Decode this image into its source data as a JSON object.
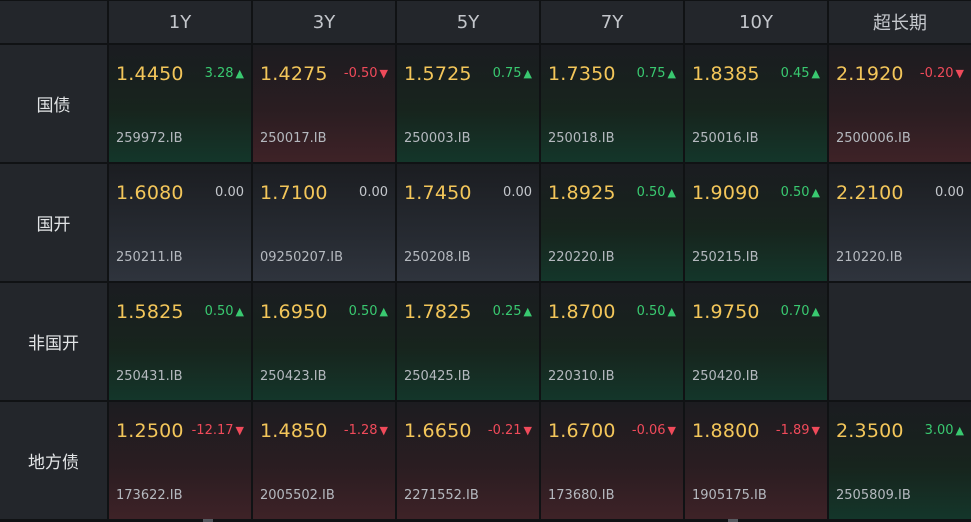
{
  "columns": [
    "1Y",
    "3Y",
    "5Y",
    "7Y",
    "10Y",
    "超长期"
  ],
  "rows": [
    {
      "label": "国债",
      "cells": [
        {
          "price": "1.4450",
          "change": "3.28",
          "trend": "up",
          "code": "259972.IB"
        },
        {
          "price": "1.4275",
          "change": "-0.50",
          "trend": "down",
          "code": "250017.IB"
        },
        {
          "price": "1.5725",
          "change": "0.75",
          "trend": "up",
          "code": "250003.IB"
        },
        {
          "price": "1.7350",
          "change": "0.75",
          "trend": "up",
          "code": "250018.IB"
        },
        {
          "price": "1.8385",
          "change": "0.45",
          "trend": "up",
          "code": "250016.IB"
        },
        {
          "price": "2.1920",
          "change": "-0.20",
          "trend": "down",
          "code": "2500006.IB"
        }
      ]
    },
    {
      "label": "国开",
      "cells": [
        {
          "price": "1.6080",
          "change": "0.00",
          "trend": "flat",
          "code": "250211.IB"
        },
        {
          "price": "1.7100",
          "change": "0.00",
          "trend": "flat",
          "code": "09250207.IB"
        },
        {
          "price": "1.7450",
          "change": "0.00",
          "trend": "flat",
          "code": "250208.IB"
        },
        {
          "price": "1.8925",
          "change": "0.50",
          "trend": "up",
          "code": "220220.IB"
        },
        {
          "price": "1.9090",
          "change": "0.50",
          "trend": "up",
          "code": "250215.IB"
        },
        {
          "price": "2.2100",
          "change": "0.00",
          "trend": "flat",
          "code": "210220.IB"
        }
      ]
    },
    {
      "label": "非国开",
      "cells": [
        {
          "price": "1.5825",
          "change": "0.50",
          "trend": "up",
          "code": "250431.IB"
        },
        {
          "price": "1.6950",
          "change": "0.50",
          "trend": "up",
          "code": "250423.IB"
        },
        {
          "price": "1.7825",
          "change": "0.25",
          "trend": "up",
          "code": "250425.IB"
        },
        {
          "price": "1.8700",
          "change": "0.50",
          "trend": "up",
          "code": "220310.IB"
        },
        {
          "price": "1.9750",
          "change": "0.70",
          "trend": "up",
          "code": "250420.IB"
        },
        null
      ]
    },
    {
      "label": "地方债",
      "cells": [
        {
          "price": "1.2500",
          "change": "-12.17",
          "trend": "down",
          "code": "173622.IB"
        },
        {
          "price": "1.4850",
          "change": "-1.28",
          "trend": "down",
          "code": "2005502.IB"
        },
        {
          "price": "1.6650",
          "change": "-0.21",
          "trend": "down",
          "code": "2271552.IB"
        },
        {
          "price": "1.6700",
          "change": "-0.06",
          "trend": "down",
          "code": "173680.IB"
        },
        {
          "price": "1.8800",
          "change": "-1.89",
          "trend": "down",
          "code": "1905175.IB"
        },
        {
          "price": "2.3500",
          "change": "3.00",
          "trend": "up",
          "code": "2505809.IB"
        }
      ]
    }
  ],
  "colors": {
    "price": "#f3c65a",
    "up": "#39c970",
    "down": "#f04a5a",
    "flat": "#c4c7cc"
  },
  "icons": {
    "up": "triangle-up-icon",
    "down": "triangle-down-icon"
  }
}
